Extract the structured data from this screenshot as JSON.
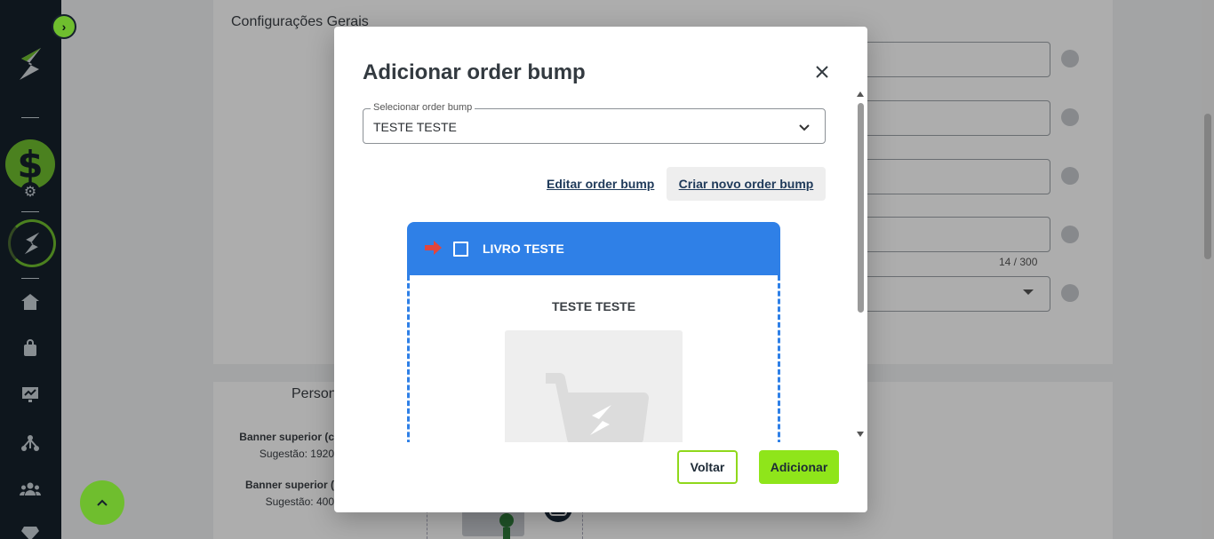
{
  "colors": {
    "sidebar_bg": "#16212c",
    "brand_green": "#6fbe2e",
    "accent_lime": "#8fe51a",
    "bump_blue": "#2f80e7",
    "arrow_red": "#e2453c"
  },
  "sidebar": {
    "collapse_icon": "chevron-right-icon",
    "items": [
      {
        "icon": "logo-icon"
      },
      {
        "icon": "dollar-icon"
      },
      {
        "icon": "gear-icon"
      },
      {
        "icon": "brand-ring-icon"
      },
      {
        "icon": "home-icon"
      },
      {
        "icon": "bag-icon"
      },
      {
        "icon": "chart-icon"
      },
      {
        "icon": "network-icon"
      },
      {
        "icon": "users-icon"
      },
      {
        "icon": "diamond-icon"
      }
    ]
  },
  "background_page": {
    "section_title": "Configurações Gerais",
    "char_counter": "14 / 300",
    "section2_title": "Person",
    "banner1_label": "Banner superior (c",
    "banner1_hint": "Sugestão: 1920",
    "banner2_label": "Banner superior (",
    "banner2_hint": "Sugestão: 400"
  },
  "modal": {
    "title": "Adicionar order bump",
    "close_icon": "close-icon",
    "select": {
      "legend": "Selecionar order bump",
      "value": "TESTE TESTE"
    },
    "edit_link": "Editar order bump",
    "create_button": "Criar novo order bump",
    "preview": {
      "header_title": "LIVRO TESTE",
      "offer_name": "TESTE TESTE"
    },
    "back_button": "Voltar",
    "add_button": "Adicionar"
  }
}
